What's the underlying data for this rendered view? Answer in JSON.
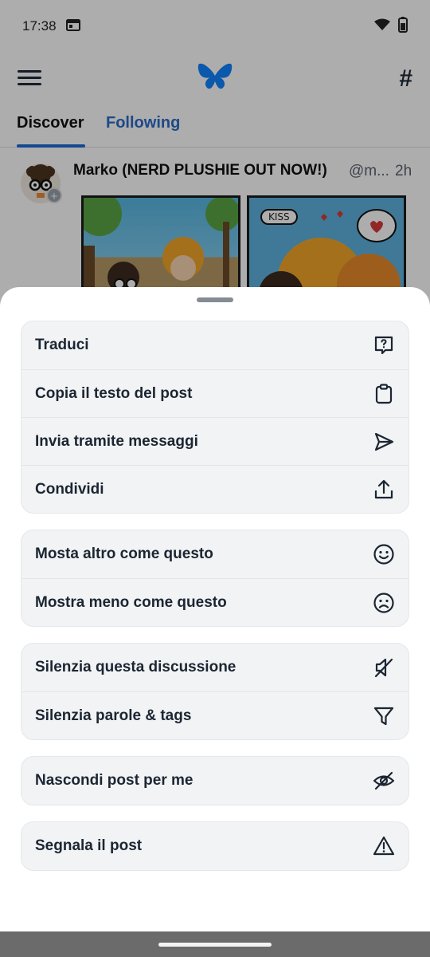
{
  "status": {
    "time": "17:38"
  },
  "tabs": {
    "discover": "Discover",
    "following": "Following"
  },
  "post": {
    "author": "Marko (NERD PLUSHIE OUT NOW!)",
    "handle": "@m...",
    "time": "2h",
    "comic_text": "KISS"
  },
  "menu": {
    "groups": [
      [
        {
          "label": "Traduci",
          "icon": "translate-icon"
        },
        {
          "label": "Copia il testo del post",
          "icon": "clipboard-icon"
        },
        {
          "label": "Invia tramite messaggi",
          "icon": "send-icon"
        },
        {
          "label": "Condividi",
          "icon": "share-icon"
        }
      ],
      [
        {
          "label": "Mosta altro come questo",
          "icon": "smile-icon"
        },
        {
          "label": "Mostra meno come questo",
          "icon": "frown-icon"
        }
      ],
      [
        {
          "label": "Silenzia questa discussione",
          "icon": "mute-icon"
        },
        {
          "label": "Silenzia parole & tags",
          "icon": "filter-icon"
        }
      ],
      [
        {
          "label": "Nascondi post per me",
          "icon": "eye-slash-icon"
        }
      ],
      [
        {
          "label": "Segnala il post",
          "icon": "warning-icon"
        }
      ]
    ]
  },
  "colors": {
    "accent": "#1e6ad6",
    "logo": "#1083fe",
    "sheet_group_bg": "#f1f3f5",
    "text": "#1c2632"
  }
}
